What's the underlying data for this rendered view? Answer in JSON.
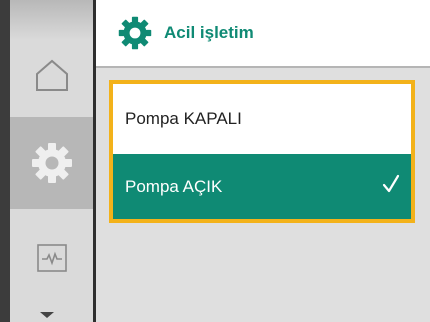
{
  "header": {
    "title": "Acil işletim",
    "icon": "gear-icon"
  },
  "nav": {
    "items": [
      {
        "icon": "home-icon",
        "active": false
      },
      {
        "icon": "gear-icon",
        "active": true
      },
      {
        "icon": "diagnostics-icon",
        "active": false
      }
    ],
    "scroll_icon": "chevron-down-icon"
  },
  "options": [
    {
      "label": "Pompa KAPALI",
      "selected": false
    },
    {
      "label": "Pompa AÇIK",
      "selected": true
    }
  ],
  "colors": {
    "accent": "#0f8a74",
    "focus": "#f3b21a",
    "nav_bg": "#dadada",
    "content_bg": "#dfdfdf"
  }
}
